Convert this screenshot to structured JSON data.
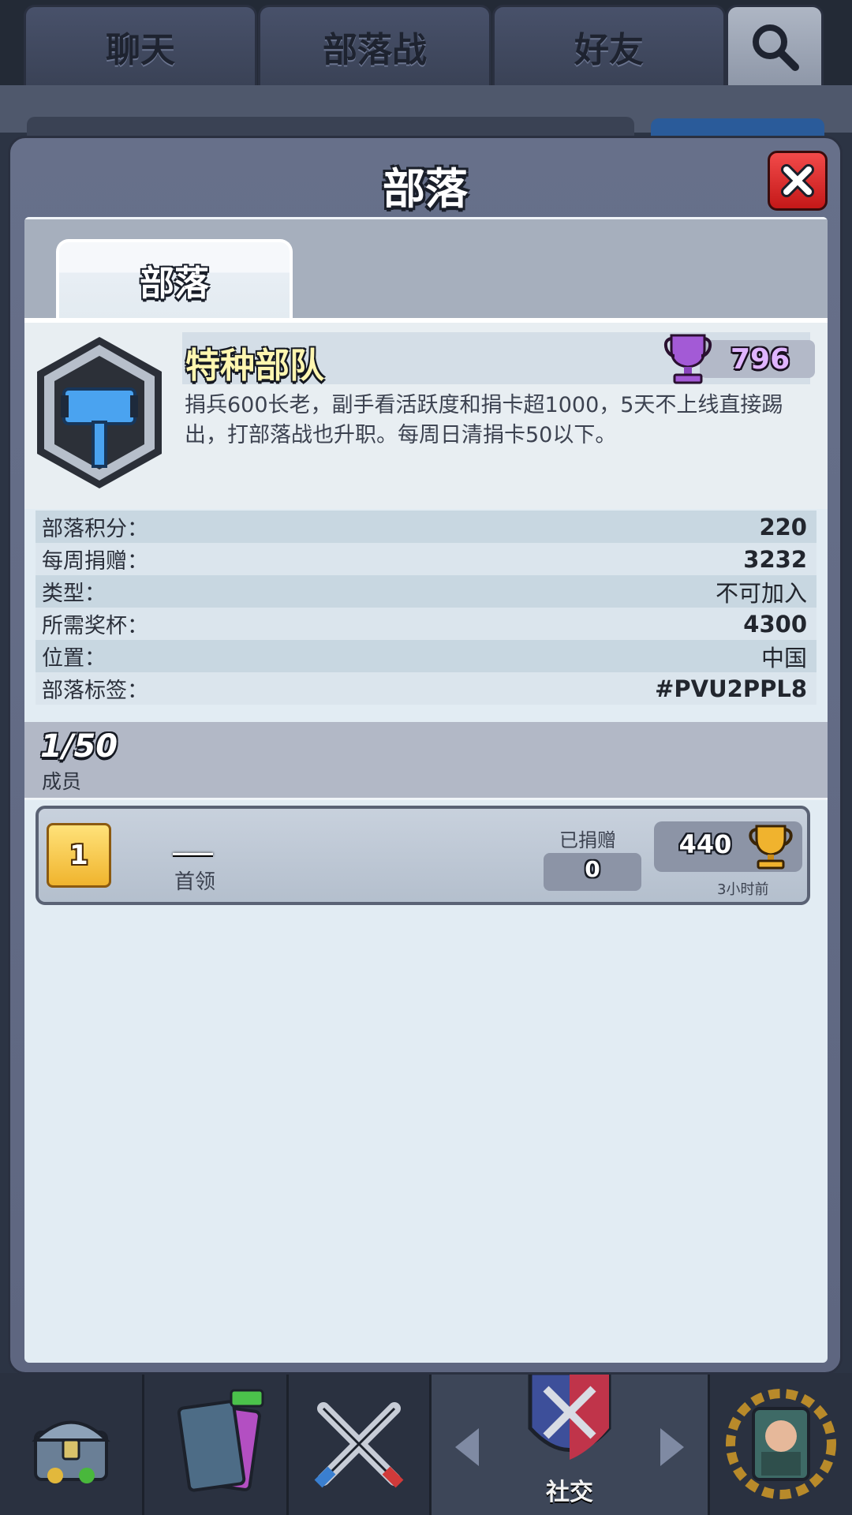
{
  "top_tabs": [
    {
      "label": "聊天"
    },
    {
      "label": "部落战"
    },
    {
      "label": "好友"
    }
  ],
  "bottom_nav": {
    "active_label": "社交"
  },
  "modal": {
    "title": "部落",
    "tab_label": "部落"
  },
  "clan": {
    "name": "特种部队",
    "trophies": "796",
    "description": "捐兵600长老，副手看活跃度和捐卡超1000，5天不上线直接踢出，打部落战也升职。每周日清捐卡50以下。",
    "stats": [
      {
        "label": "部落积分：",
        "value": "220"
      },
      {
        "label": "每周捐赠：",
        "value": "3232"
      },
      {
        "label": "类型：",
        "value": "不可加入"
      },
      {
        "label": "所需奖杯：",
        "value": "4300"
      },
      {
        "label": "位置：",
        "value": "中国"
      },
      {
        "label": "部落标签：",
        "value": "#PVU2PPL8"
      }
    ]
  },
  "members": {
    "count": "1/50",
    "label": "成员",
    "list": [
      {
        "rank": "1",
        "name": "___",
        "role": "首领",
        "donated_label": "已捐赠",
        "donated": "0",
        "trophies": "440",
        "last_seen": "3小时前"
      }
    ]
  },
  "colors": {
    "close_button": "#e12b2b",
    "rank_badge": "#f5c64a",
    "clan_name": "#fff6b0",
    "trophy_purple": "#b57ae0"
  }
}
